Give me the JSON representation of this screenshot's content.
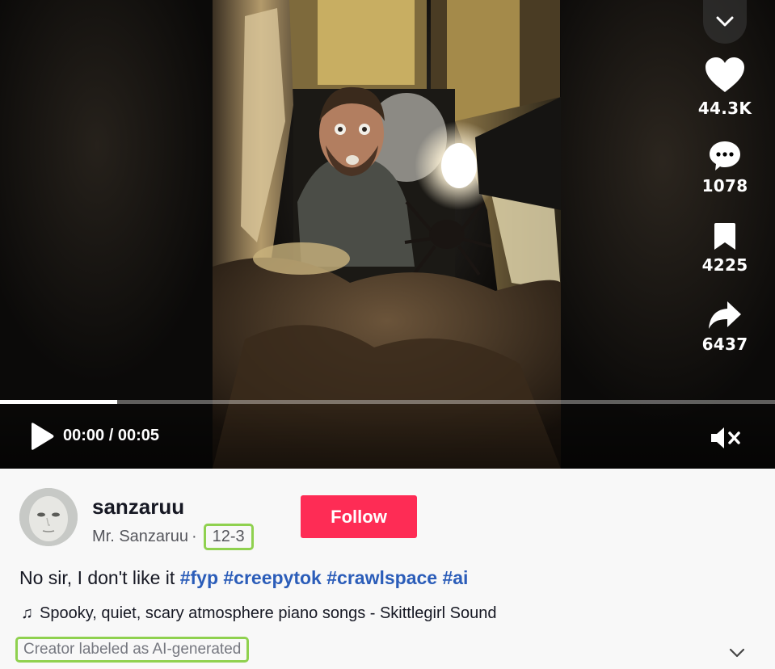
{
  "video": {
    "current_time": "00:00 / 00:05",
    "progress_fraction": 0.151
  },
  "actions": {
    "likes": "44.3K",
    "comments": "1078",
    "saves": "4225",
    "shares": "6437"
  },
  "author": {
    "username": "sanzaruu",
    "display_name": "Mr. Sanzaruu",
    "separator": "·",
    "post_date": "12-3"
  },
  "follow_label": "Follow",
  "caption": {
    "text": "No sir, I don't like it",
    "hashtags": [
      "#fyp",
      "#creepytok",
      "#crawlspace",
      "#ai"
    ]
  },
  "music": {
    "note_icon": "♫",
    "title": "Spooky, quiet, scary atmosphere piano songs - Skittlegirl Sound"
  },
  "ai_label": "Creator labeled as AI-generated",
  "colors": {
    "follow": "#fe2c55",
    "hashtag": "#2b5db9",
    "highlight_box": "#8fd14f"
  }
}
